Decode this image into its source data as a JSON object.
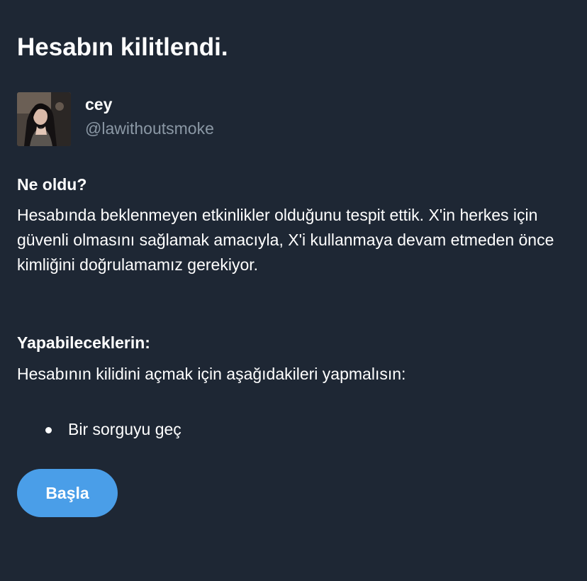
{
  "header": {
    "title": "Hesabın kilitlendi."
  },
  "account": {
    "display_name": "cey",
    "handle": "@lawithoutsmoke",
    "avatar_icon": "profile-photo"
  },
  "what_happened": {
    "heading": "Ne oldu?",
    "body": "Hesabında beklenmeyen etkinlikler olduğunu tespit ettik. X'in herkes için güvenli olmasını sağlamak amacıyla, X'i kullanmaya devam etmeden önce kimliğini doğrulamamız gerekiyor."
  },
  "what_you_can_do": {
    "heading": "Yapabileceklerin:",
    "body": "Hesabının kilidini açmak için aşağıdakileri yapmalısın:",
    "items": [
      {
        "label": "Bir sorguyu geç"
      }
    ]
  },
  "actions": {
    "start_label": "Başla"
  },
  "colors": {
    "background": "#1e2734",
    "text_primary": "#ffffff",
    "text_secondary": "#8b98a5",
    "accent": "#4a9ee8"
  }
}
